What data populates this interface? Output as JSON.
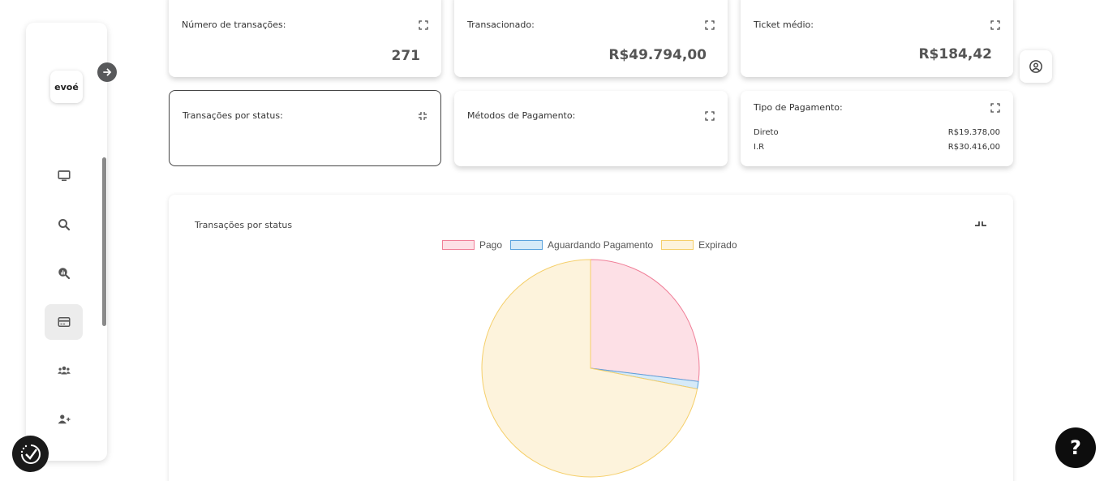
{
  "sidebar": {
    "logo": "evoé",
    "items": [
      {
        "icon": "monitor-icon"
      },
      {
        "icon": "search-icon"
      },
      {
        "icon": "analytics-search-icon"
      },
      {
        "icon": "credit-card-icon",
        "active": true
      },
      {
        "icon": "users-group-icon"
      },
      {
        "icon": "user-add-icon"
      }
    ]
  },
  "cards": {
    "transactions_count": {
      "label": "Número de transações:",
      "value": "271"
    },
    "transacted": {
      "label": "Transacionado:",
      "value": "R$49.794,00"
    },
    "ticket": {
      "label": "Ticket médio:",
      "value": "R$184,42"
    },
    "by_status": {
      "label": "Transações por status:"
    },
    "payment_methods": {
      "label": "Métodos de Pagamento:"
    },
    "payment_type": {
      "label": "Tipo de Pagamento:",
      "rows": [
        {
          "name": "Direto",
          "value": "R$19.378,00"
        },
        {
          "name": "I.R",
          "value": "R$30.416,00"
        }
      ]
    }
  },
  "chart_panel": {
    "title": "Transações por status"
  },
  "chart_data": {
    "type": "pie",
    "title": "",
    "series": [
      {
        "name": "Pago",
        "value": 73,
        "fill": "#fde0e6",
        "stroke": "#f07f98"
      },
      {
        "name": "Aguardando Pagamento",
        "value": 3,
        "fill": "#d6eaf8",
        "stroke": "#5aa2dd"
      },
      {
        "name": "Expirado",
        "value": 195,
        "fill": "#fdf3dc",
        "stroke": "#f5cf6a"
      }
    ],
    "legend": "top-center"
  },
  "help": {
    "label": "?"
  }
}
